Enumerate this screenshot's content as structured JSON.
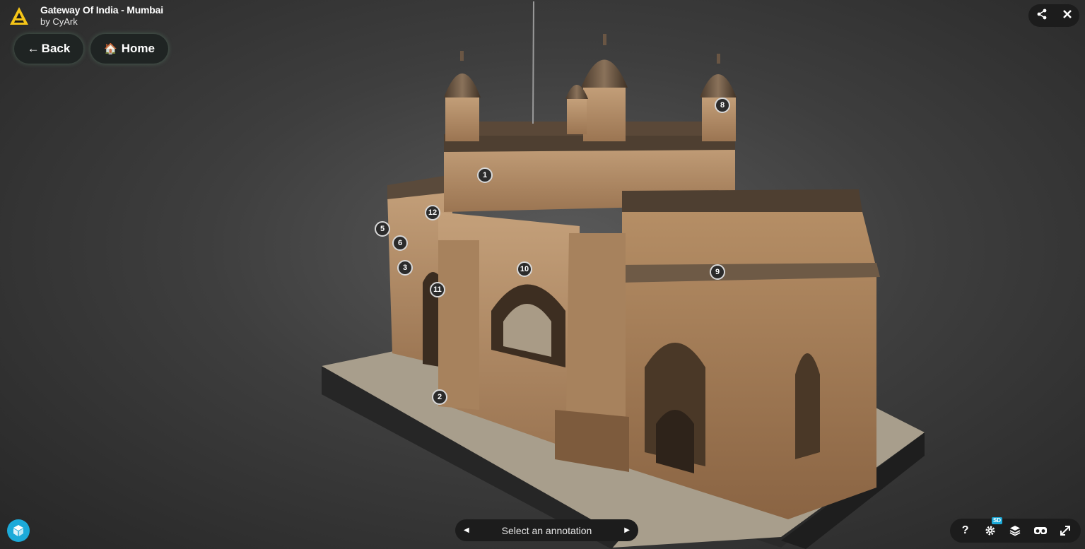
{
  "header": {
    "title": "Gateway Of India - Mumbai",
    "byline": "by CyArk",
    "logo_icon": "cyark-logo-icon",
    "accent_color": "#f5c518"
  },
  "nav": {
    "back_arrow": "←",
    "back_label": "Back",
    "home_icon": "🏠",
    "home_label": "Home"
  },
  "top_right": {
    "share_icon": "share-icon",
    "close_icon": "close-icon"
  },
  "annotations": [
    {
      "number": "1"
    },
    {
      "number": "2"
    },
    {
      "number": "3"
    },
    {
      "number": "5"
    },
    {
      "number": "6"
    },
    {
      "number": "8"
    },
    {
      "number": "9"
    },
    {
      "number": "10"
    },
    {
      "number": "11"
    },
    {
      "number": "12"
    }
  ],
  "annotation_nav": {
    "label": "Select an annotation",
    "prev_icon": "◀",
    "next_icon": "▶"
  },
  "toolbar": {
    "help_label": "?",
    "settings_badge": "SD",
    "brand_color": "#1caad9"
  }
}
